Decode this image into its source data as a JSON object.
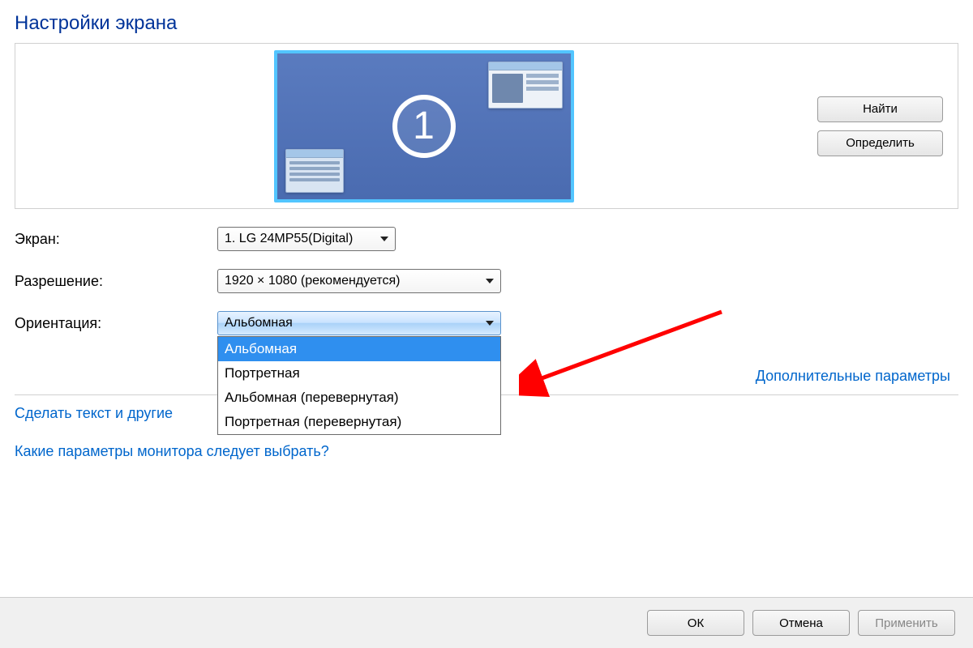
{
  "title": "Настройки экрана",
  "monitor": {
    "number": "1"
  },
  "buttons": {
    "detect": "Найти",
    "identify": "Определить"
  },
  "labels": {
    "display": "Экран:",
    "resolution": "Разрешение:",
    "orientation": "Ориентация:"
  },
  "values": {
    "display": "1. LG 24MP55(Digital)",
    "resolution": "1920 × 1080 (рекомендуется)",
    "orientation": "Альбомная"
  },
  "orientation_options": [
    "Альбомная",
    "Портретная",
    "Альбомная (перевернутая)",
    "Портретная (перевернутая)"
  ],
  "links": {
    "advanced": "Дополнительные параметры",
    "text_size": "Сделать текст и другие",
    "which_settings": "Какие параметры монитора следует выбрать?"
  },
  "footer": {
    "ok": "ОК",
    "cancel": "Отмена",
    "apply": "Применить"
  }
}
